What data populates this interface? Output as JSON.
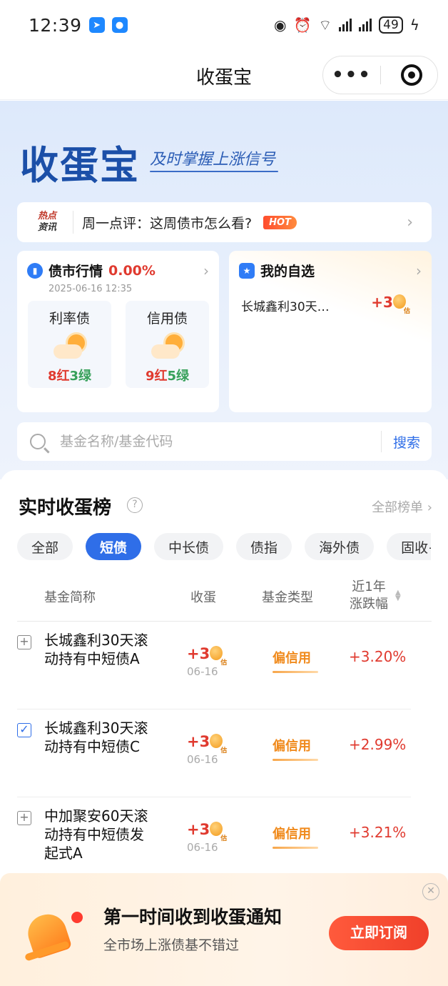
{
  "status": {
    "time": "12:39",
    "battery": "49"
  },
  "nav": {
    "title": "收蛋宝"
  },
  "hero": {
    "title": "收蛋宝",
    "slogan": "及时掌握上涨信号"
  },
  "news": {
    "tag_line1": "热点",
    "tag_line2": "资讯",
    "text": "周一点评：这周债市怎么看?",
    "hot": "HOT"
  },
  "bond_card": {
    "title": "债市行情",
    "change": "0.00%",
    "time": "2025-06-16 12:35",
    "items": [
      {
        "title": "利率债",
        "red": "8红",
        "green": "3绿"
      },
      {
        "title": "信用债",
        "red": "9红",
        "green": "5绿"
      }
    ]
  },
  "watch_card": {
    "title": "我的自选",
    "item": "长城鑫利30天…",
    "value": "+3",
    "est": "估"
  },
  "search": {
    "placeholder": "基金名称/基金代码",
    "button": "搜索"
  },
  "ranking": {
    "title": "实时收蛋榜",
    "all": "全部榜单",
    "tabs": [
      "全部",
      "短债",
      "中长债",
      "债指",
      "海外债",
      "固收+"
    ],
    "active_tab": "短债",
    "headers": {
      "name": "基金简称",
      "egg": "收蛋",
      "type": "基金类型",
      "change_l1": "近1年",
      "change_l2": "涨跌幅"
    },
    "rows": [
      {
        "name": "长城鑫利30天滚动持有中短债A",
        "egg": "+3",
        "est": "估",
        "date": "06-16",
        "type": "偏信用",
        "change": "+3.20%",
        "checked": false
      },
      {
        "name": "长城鑫利30天滚动持有中短债C",
        "egg": "+3",
        "est": "估",
        "date": "06-16",
        "type": "偏信用",
        "change": "+2.99%",
        "checked": true
      },
      {
        "name": "中加聚安60天滚动持有中短债发起式A",
        "egg": "+3",
        "est": "估",
        "date": "06-16",
        "type": "偏信用",
        "change": "+3.21%",
        "checked": false
      }
    ]
  },
  "subscribe": {
    "title": "第一时间收到收蛋通知",
    "desc": "全市场上涨债基不错过",
    "button": "立即订阅"
  },
  "colors": {
    "accent": "#2f6ee8",
    "up": "#e03a2f",
    "down": "#36a05a",
    "egg": "#f39b1e"
  }
}
